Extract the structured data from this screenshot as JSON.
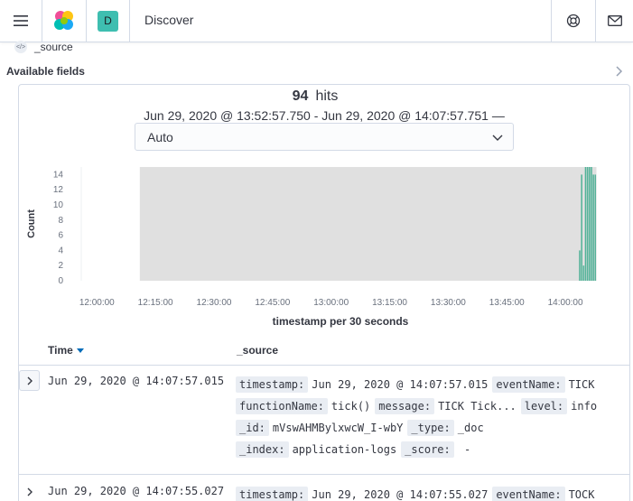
{
  "header": {
    "title": "Discover",
    "space_initial": "D"
  },
  "sidebar": {
    "source_field": "_source",
    "available_fields": "Available fields"
  },
  "summary": {
    "hits_count": "94",
    "hits_label": "hits",
    "range": "Jun 29, 2020 @ 13:52:57.750 - Jun 29, 2020 @ 14:07:57.751 —",
    "interval": "Auto"
  },
  "chart_data": {
    "type": "bar",
    "xlabel": "timestamp per 30 seconds",
    "ylabel": "Count",
    "ylim": [
      0,
      15
    ],
    "yticks": [
      0,
      2,
      4,
      6,
      8,
      10,
      12,
      14
    ],
    "xticks": [
      "12:00:00",
      "12:15:00",
      "12:30:00",
      "12:45:00",
      "13:00:00",
      "13:15:00",
      "13:30:00",
      "13:45:00",
      "14:00:00"
    ],
    "x_start": "11:56:00",
    "x_end": "14:09:00",
    "selection_start": "12:11:00",
    "selection_end": "14:07:57",
    "bars": [
      {
        "time": "14:03:30",
        "value": 4
      },
      {
        "time": "14:04:00",
        "value": 14
      },
      {
        "time": "14:04:30",
        "value": 2
      },
      {
        "time": "14:05:00",
        "value": 15
      },
      {
        "time": "14:05:30",
        "value": 15
      },
      {
        "time": "14:06:00",
        "value": 15
      },
      {
        "time": "14:06:30",
        "value": 15
      },
      {
        "time": "14:07:00",
        "value": 14
      },
      {
        "time": "14:07:30",
        "value": 14
      }
    ],
    "bar_color": "#54b399",
    "selection_color": "#e0e0e0",
    "grid": false
  },
  "table": {
    "col_time": "Time",
    "col_source": "_source",
    "rows": [
      {
        "time": "Jun 29, 2020 @ 14:07:57.015",
        "fields": [
          {
            "key": "timestamp:",
            "value": "Jun 29, 2020 @ 14:07:57.015"
          },
          {
            "key": "eventName:",
            "value": "TICK"
          },
          {
            "key": "functionName:",
            "value": "tick()"
          },
          {
            "key": "message:",
            "value": "TICK Tick..."
          },
          {
            "key": "level:",
            "value": "info"
          },
          {
            "key": "_id:",
            "value": "mVswAHMBylxwcW_I-wbY"
          },
          {
            "key": "_type:",
            "value": "_doc"
          },
          {
            "key": "_index:",
            "value": "application-logs"
          },
          {
            "key": "_score:",
            "value": " -"
          }
        ]
      },
      {
        "time": "Jun 29, 2020 @ 14:07:55.027",
        "fields": [
          {
            "key": "timestamp:",
            "value": "Jun 29, 2020 @ 14:07:55.027"
          },
          {
            "key": "eventName:",
            "value": "TOCK"
          }
        ]
      }
    ]
  }
}
